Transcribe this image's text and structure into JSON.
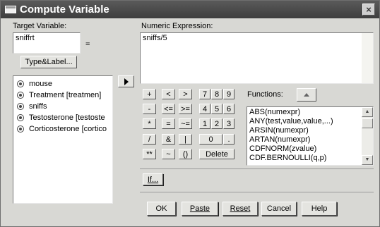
{
  "window": {
    "title": "Compute Variable",
    "close_glyph": "×"
  },
  "target": {
    "label": "Target Variable:",
    "value": "sniffrt",
    "equals": "=",
    "type_label_button": "Type&Label..."
  },
  "variables": {
    "items": [
      "mouse",
      "Treatment [treatmen]",
      "sniffs",
      "Testosterone [testoste",
      "Corticosterone [cortico"
    ]
  },
  "expression": {
    "label": "Numeric Expression:",
    "value": "sniffs/5"
  },
  "calculator": {
    "keys": [
      "+",
      "<",
      ">",
      "7",
      "8",
      "9",
      "-",
      "<=",
      ">=",
      "4",
      "5",
      "6",
      "*",
      "=",
      "~=",
      "1",
      "2",
      "3",
      "/",
      "&",
      "|",
      "0",
      ".",
      "**",
      "~",
      "()",
      "Delete"
    ]
  },
  "functions": {
    "label": "Functions:",
    "items": [
      "ABS(numexpr)",
      "ANY(test,value,value,...)",
      "ARSIN(numexpr)",
      "ARTAN(numexpr)",
      "CDFNORM(zvalue)",
      "CDF.BERNOULLI(q,p)"
    ]
  },
  "buttons": {
    "if": "If...",
    "ok": "OK",
    "paste": "Paste",
    "reset": "Reset",
    "cancel": "Cancel",
    "help": "Help"
  },
  "icons": {
    "move_right": "triangle-right-icon",
    "variable": "numeric-variable-icon",
    "close": "close-icon"
  }
}
